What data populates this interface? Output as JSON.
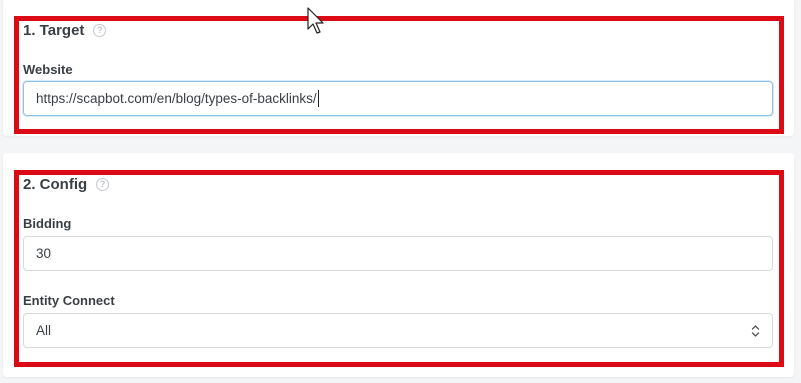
{
  "target": {
    "title": "1. Target",
    "help_glyph": "?",
    "website_label": "Website",
    "website_value": "https://scapbot.com/en/blog/types-of-backlinks/"
  },
  "config": {
    "title": "2. Config",
    "help_glyph": "?",
    "bidding_label": "Bidding",
    "bidding_value": "30",
    "entity_label": "Entity Connect",
    "entity_value": "All"
  },
  "colors": {
    "highlight": "#dc0a14",
    "focus_border": "#8ec2e8"
  },
  "icons": [
    "help-icon",
    "select-updown-icon",
    "mouse-cursor-icon"
  ]
}
